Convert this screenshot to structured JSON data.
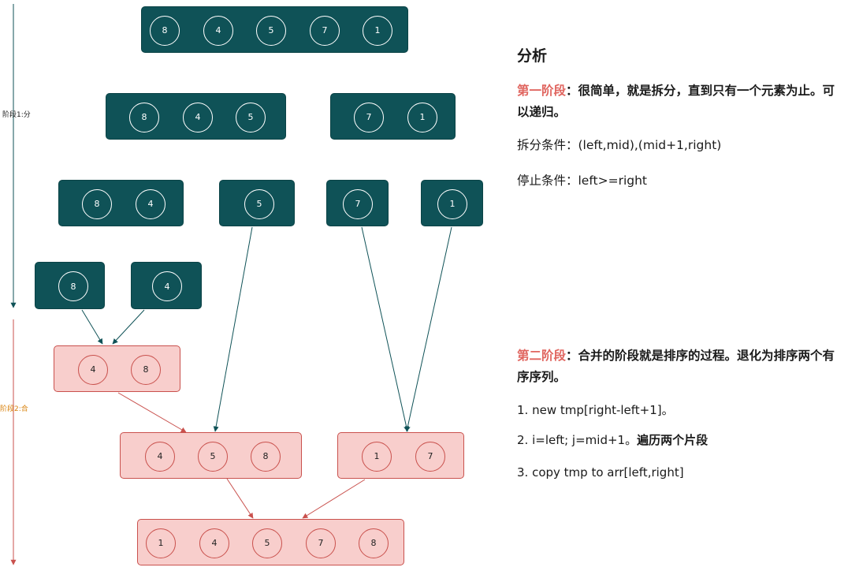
{
  "stage_labels": {
    "split": "阶段1:分",
    "merge": "阶段2:合"
  },
  "nodes": [
    {
      "id": "r0",
      "values": [
        "8",
        "4",
        "5",
        "7",
        "1"
      ],
      "tone": "split"
    },
    {
      "id": "r1a",
      "values": [
        "8",
        "4",
        "5"
      ],
      "tone": "split"
    },
    {
      "id": "r1b",
      "values": [
        "7",
        "1"
      ],
      "tone": "split"
    },
    {
      "id": "r2a",
      "values": [
        "8",
        "4"
      ],
      "tone": "split"
    },
    {
      "id": "r2b",
      "values": [
        "5"
      ],
      "tone": "split"
    },
    {
      "id": "r2c",
      "values": [
        "7"
      ],
      "tone": "split"
    },
    {
      "id": "r2d",
      "values": [
        "1"
      ],
      "tone": "split"
    },
    {
      "id": "r3a",
      "values": [
        "8"
      ],
      "tone": "split"
    },
    {
      "id": "r3b",
      "values": [
        "4"
      ],
      "tone": "split"
    },
    {
      "id": "m1",
      "values": [
        "4",
        "8"
      ],
      "tone": "merge"
    },
    {
      "id": "m2a",
      "values": [
        "4",
        "5",
        "8"
      ],
      "tone": "merge"
    },
    {
      "id": "m2b",
      "values": [
        "1",
        "7"
      ],
      "tone": "merge"
    },
    {
      "id": "m3",
      "values": [
        "1",
        "4",
        "5",
        "7",
        "8"
      ],
      "tone": "merge"
    }
  ],
  "edges": [
    {
      "from": "r3a",
      "to": "m1",
      "color": "#0f5257"
    },
    {
      "from": "r3b",
      "to": "m1",
      "color": "#0f5257"
    },
    {
      "from": "r2b",
      "to": "m2a",
      "color": "#0f5257"
    },
    {
      "from": "r2c",
      "to": "m2b",
      "color": "#0f5257"
    },
    {
      "from": "r2d",
      "to": "m2b",
      "color": "#0f5257"
    },
    {
      "from": "m1",
      "to": "m2a",
      "color": "#c9514d"
    },
    {
      "from": "m2a",
      "to": "m3",
      "color": "#c9514d"
    },
    {
      "from": "m2b",
      "to": "m3",
      "color": "#c9514d"
    }
  ],
  "colors": {
    "split_fill": "#0f5257",
    "merge_fill": "#f8cecc",
    "merge_stroke": "#c9514d",
    "highlight": "#e0655f",
    "merge_label": "#d9830f"
  },
  "panel": {
    "title": "分析",
    "stage1": {
      "label": "第一阶段",
      "text": "：很简单，就是拆分，直到只有一个元素为止。可以递归。"
    },
    "split_condition": "拆分条件：(left,mid),(mid+1,right)",
    "stop_condition": "停止条件：left>=right",
    "stage2": {
      "label": "第二阶段",
      "text": "：合并的阶段就是排序的过程。退化为排序两个有序序列。"
    },
    "steps": [
      {
        "text": "1. new tmp[right-left+1]。"
      },
      {
        "text": "2. i=left; j=mid+1。",
        "bold": "遍历两个片段"
      },
      {
        "text": "3. copy tmp to arr[left,right]"
      }
    ]
  }
}
